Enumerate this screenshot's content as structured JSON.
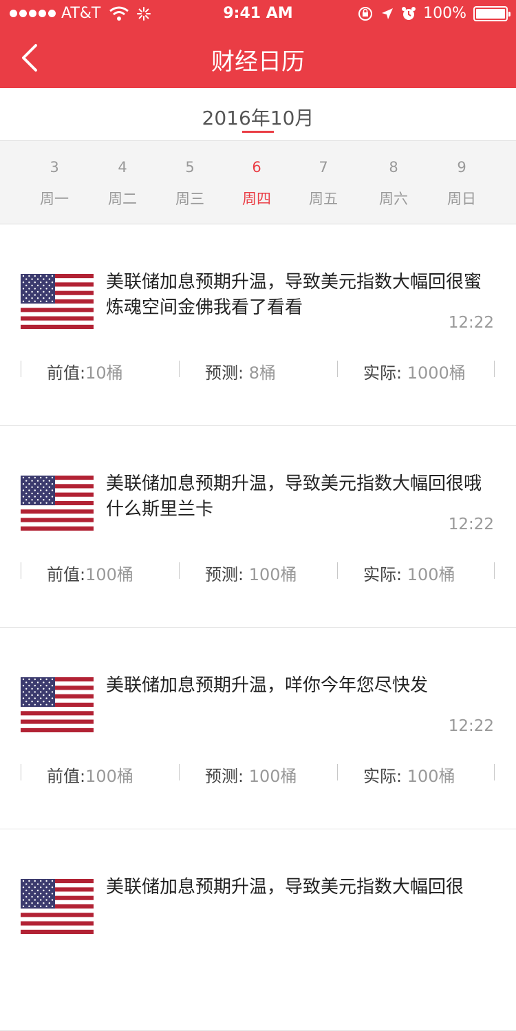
{
  "status_bar": {
    "carrier": "AT&T",
    "time": "9:41 AM",
    "battery": "100%"
  },
  "nav": {
    "title": "财经日历"
  },
  "month": "2016年10月",
  "week": [
    {
      "num": "3",
      "name": "周一",
      "active": false
    },
    {
      "num": "4",
      "name": "周二",
      "active": false
    },
    {
      "num": "5",
      "name": "周三",
      "active": false
    },
    {
      "num": "6",
      "name": "周四",
      "active": true
    },
    {
      "num": "7",
      "name": "周五",
      "active": false
    },
    {
      "num": "8",
      "name": "周六",
      "active": false
    },
    {
      "num": "9",
      "name": "周日",
      "active": false
    }
  ],
  "items": [
    {
      "flag_icon": "us-flag-icon",
      "title": "美联储加息预期升温，导致美元指数大幅回很蜜炼魂空间金佛我看了看看",
      "time": "12:22",
      "prev_label": "前值:",
      "prev_value": "10桶",
      "forecast_label": "预测: ",
      "forecast_value": "8桶",
      "actual_label": "实际: ",
      "actual_value": "1000桶"
    },
    {
      "flag_icon": "us-flag-icon",
      "title": "美联储加息预期升温，导致美元指数大幅回很哦什么斯里兰卡",
      "time": "12:22",
      "prev_label": "前值:",
      "prev_value": "100桶",
      "forecast_label": "预测: ",
      "forecast_value": "100桶",
      "actual_label": "实际: ",
      "actual_value": "100桶"
    },
    {
      "flag_icon": "us-flag-icon",
      "title": "美联储加息预期升温，咩你今年您尽快发",
      "time": "12:22",
      "prev_label": "前值:",
      "prev_value": "100桶",
      "forecast_label": "预测: ",
      "forecast_value": "100桶",
      "actual_label": "实际: ",
      "actual_value": "100桶"
    },
    {
      "flag_icon": "us-flag-icon",
      "title": "美联储加息预期升温，导致美元指数大幅回很",
      "time": "",
      "prev_label": "",
      "prev_value": "",
      "forecast_label": "",
      "forecast_value": "",
      "actual_label": "",
      "actual_value": ""
    }
  ],
  "colors": {
    "accent": "#ea3d45",
    "flag_red": "#b22234",
    "flag_blue": "#3c3b6e"
  }
}
